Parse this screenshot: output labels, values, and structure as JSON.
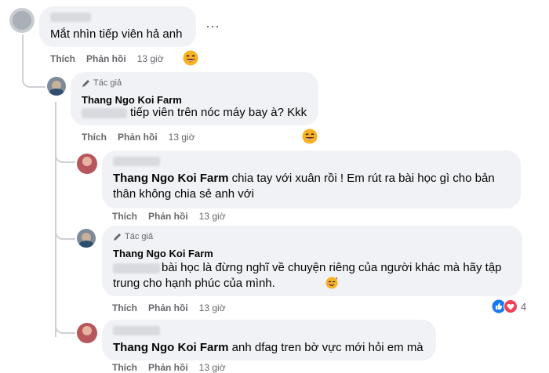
{
  "comments": [
    {
      "text": "Mắt nhìn tiếp viên hả anh",
      "actions": {
        "like": "Thích",
        "reply": "Phản hồi",
        "time": "13 giờ"
      }
    },
    {
      "author_badge": "Tác giả",
      "name": "Thang Ngo Koi Farm",
      "text": "tiếp viên trên nóc máy bay à? Kkk",
      "actions": {
        "like": "Thích",
        "reply": "Phản hồi",
        "time": "13 giờ"
      }
    },
    {
      "mention": "Thang Ngo Koi Farm",
      "text_line1": " chia tay với xuân rồi ! Em rút ra bài học gì cho bản",
      "text_line2": "thân không chia sẻ anh với",
      "actions": {
        "like": "Thích",
        "reply": "Phản hồi",
        "time": "13 giờ"
      }
    },
    {
      "author_badge": "Tác giả",
      "name": "Thang Ngo Koi Farm",
      "text_line1": " bài học là đừng nghĩ về chuyện riêng của người khác mà hãy tập",
      "text_line2": "trung cho hạnh phúc của mình.",
      "actions": {
        "like": "Thích",
        "reply": "Phản hồi",
        "time": "13 giờ"
      },
      "reactions_count": "4"
    },
    {
      "mention": "Thang Ngo Koi Farm",
      "text": " anh dfag tren bờ vực mới hỏi em mà",
      "actions": {
        "like": "Thích",
        "reply": "Phản hồi",
        "time": "13 giờ"
      }
    }
  ],
  "more_icon": "⋯",
  "colors": {
    "link": "#050505",
    "meta": "#65676b",
    "bubble": "#f0f2f5",
    "like_blue": "#1877f2",
    "love_red": "#f33e58"
  }
}
